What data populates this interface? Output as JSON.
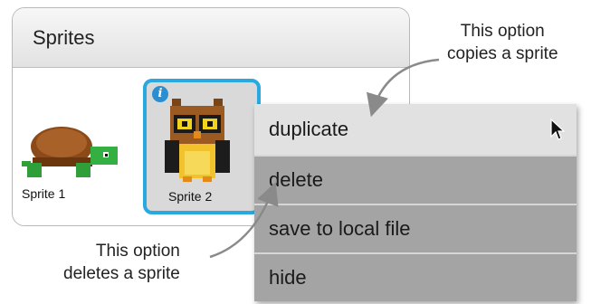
{
  "panel": {
    "title": "Sprites"
  },
  "sprites": [
    {
      "label": "Sprite 1",
      "icon": "turtle-sprite-icon",
      "selected": false
    },
    {
      "label": "Sprite 2",
      "icon": "owl-sprite-icon",
      "selected": true,
      "badge": "i"
    }
  ],
  "context_menu": {
    "items": [
      {
        "label": "duplicate",
        "highlighted": true
      },
      {
        "label": "delete",
        "highlighted": false
      },
      {
        "label": "save to local file",
        "highlighted": false
      },
      {
        "label": "hide",
        "highlighted": false
      }
    ]
  },
  "callouts": {
    "top": [
      "This option",
      "copies a sprite"
    ],
    "bottom": [
      "This option",
      "deletes a sprite"
    ]
  },
  "colors": {
    "selection_border": "#2aa8e0",
    "menu_item": "#a4a4a4",
    "menu_item_highlighted": "#e1e1e1"
  }
}
